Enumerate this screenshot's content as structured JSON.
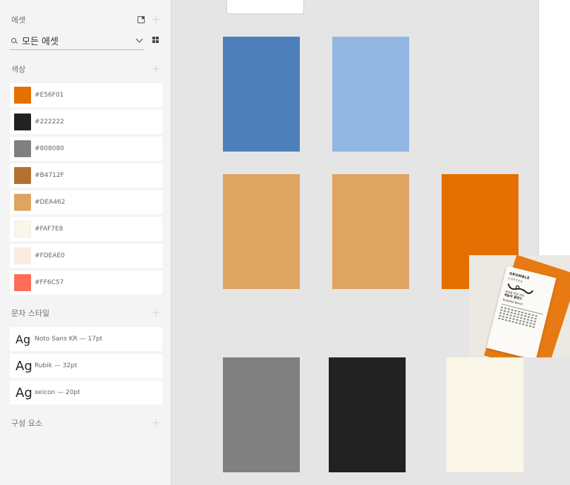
{
  "assets": {
    "title": "에셋",
    "filter_label": "모든 에셋"
  },
  "colors": {
    "title": "색상",
    "items": [
      {
        "label": "#E56F01",
        "hex": "#E56F01"
      },
      {
        "label": "#222222",
        "hex": "#222222"
      },
      {
        "label": "#808080",
        "hex": "#808080"
      },
      {
        "label": "#B4712F",
        "hex": "#B4712F"
      },
      {
        "label": "#DEA462",
        "hex": "#DEA462"
      },
      {
        "label": "#FAF7E8",
        "hex": "#FAF7E8"
      },
      {
        "label": "#FDEAE0",
        "hex": "#FDEAE0"
      },
      {
        "label": "#FF6C57",
        "hex": "#FF6C57"
      }
    ]
  },
  "char_styles": {
    "title": "문자 스타일",
    "items": [
      {
        "preview": "Ag",
        "label": "Noto Sans KR — 17pt"
      },
      {
        "preview": "Ag",
        "label": "Rubik — 32pt"
      },
      {
        "preview": "Ag",
        "label": "xeicon — 20pt"
      }
    ]
  },
  "components": {
    "title": "구성 요소"
  },
  "canvas": {
    "swatch_colors": [
      "#4D80BA",
      "#92B6E2",
      "#DEA462",
      "#DEA462",
      "#E56F01",
      "#808080",
      "#222222",
      "#FAF7E8"
    ]
  },
  "photo": {
    "brand": "GRUMBLE",
    "brand_sub": "COFFEE",
    "line1": "세상을 위한 커피",
    "line2": "체놀쳐 플렌드",
    "line3": "Roasted Blend"
  }
}
